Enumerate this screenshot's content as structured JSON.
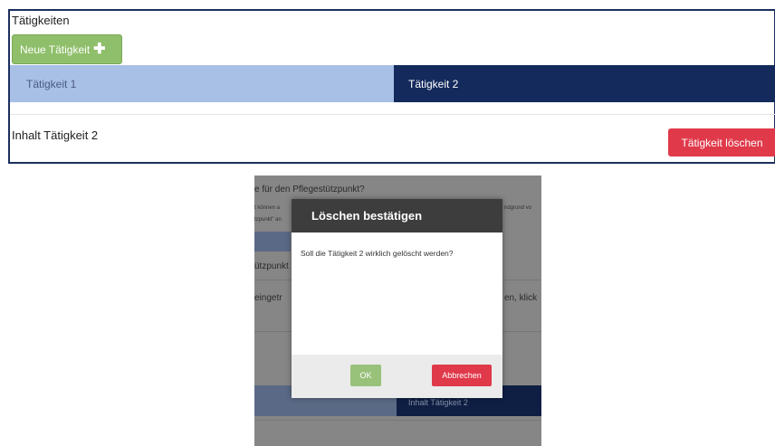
{
  "panel": {
    "title": "Tätigkeiten",
    "add_button_label": "Neue Tätigkeit",
    "add_icon": "plus-icon",
    "tabs": [
      {
        "label": "Tätigkeit 1",
        "active": false
      },
      {
        "label": "Tätigkeit 2",
        "active": true
      }
    ],
    "content_text": "Inhalt Tätigkeit 2",
    "delete_button_label": "Tätigkeit löschen"
  },
  "modal_screenshot": {
    "background": {
      "line1": "e für den Pflegestützpunkt?",
      "line2": "t können a",
      "line2_right": "ndgrund vo",
      "line3": "tzpunkt\" an",
      "line4": "ützpunkt",
      "line5": "eingetr",
      "line5_right": "en, klick",
      "tab_right_label": "Inhalt Tätigkeit 2"
    },
    "dialog": {
      "title": "Löschen bestätigen",
      "message": "Soll die Tätigkeit 2 wirklich gelöscht werden?",
      "ok_label": "OK",
      "cancel_label": "Abbrechen"
    }
  },
  "colors": {
    "panel_border": "#1c2f5e",
    "tab_inactive": "#a8bfe6",
    "tab_active": "#142a5c",
    "success": "#8fbf6a",
    "danger": "#e0394a",
    "dialog_header": "#3d3d3d"
  }
}
